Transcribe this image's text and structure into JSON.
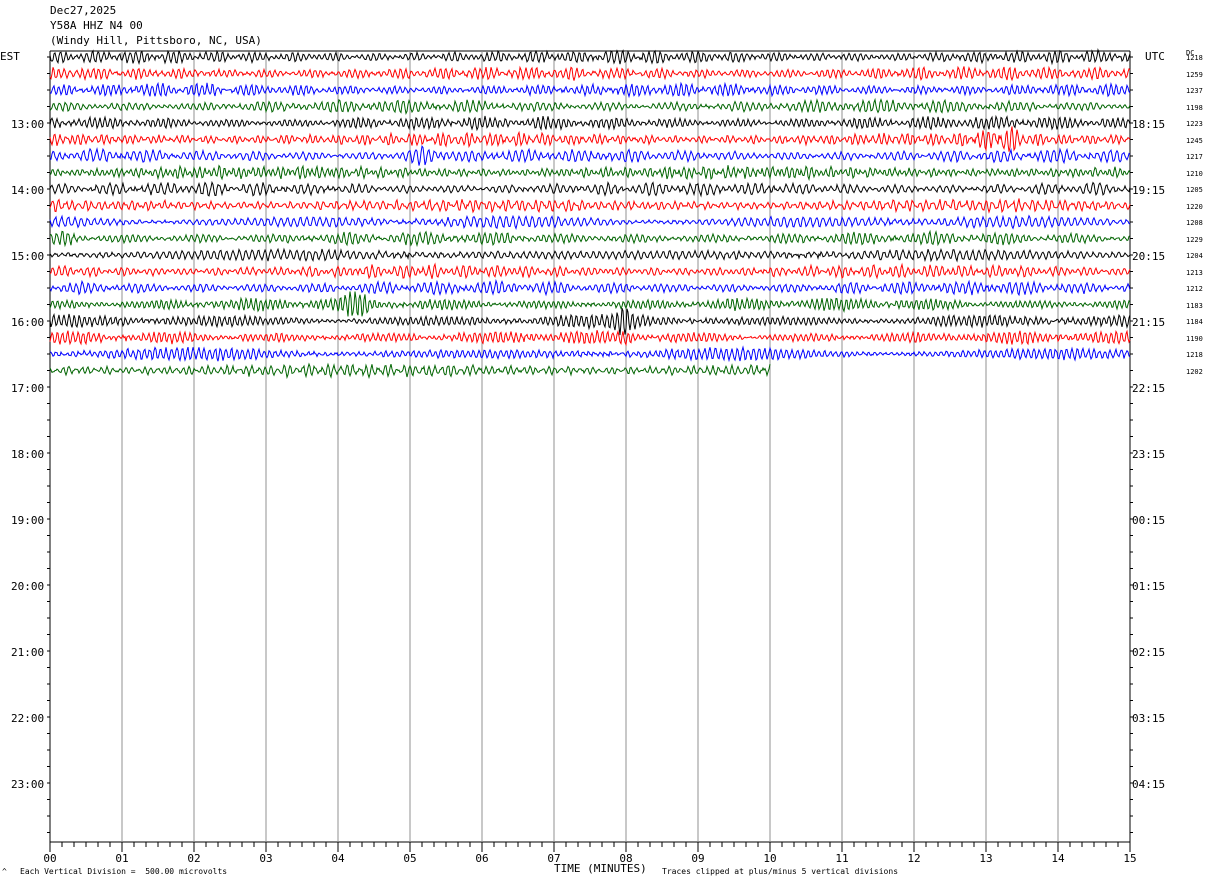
{
  "header": {
    "date": "Dec27,2025",
    "channel": "Y58A HHZ N4 00",
    "location": "(Windy Hill, Pittsboro, NC, USA)"
  },
  "left_label": "EST",
  "right_label": "UTC",
  "dc_label": "DC",
  "footer": {
    "left": "Each Vertical Division =  500.00 microvolts",
    "right": "Traces clipped at plus/minus 5 vertical divisions",
    "mark": "^"
  },
  "chart_data": {
    "type": "line",
    "title": "",
    "xlabel": "TIME (MINUTES)",
    "xlim": [
      0,
      15
    ],
    "x_ticks": [
      "00",
      "01",
      "02",
      "03",
      "04",
      "05",
      "06",
      "07",
      "08",
      "09",
      "10",
      "11",
      "12",
      "13",
      "14",
      "15"
    ],
    "est_hour_labels": [
      "13:00",
      "14:00",
      "15:00",
      "16:00",
      "17:00",
      "18:00",
      "19:00",
      "20:00",
      "21:00",
      "22:00",
      "23:00"
    ],
    "utc_hour_labels": [
      "18:15",
      "19:15",
      "20:15",
      "21:15",
      "22:15",
      "23:15",
      "00:15",
      "01:15",
      "02:15",
      "03:15",
      "04:15"
    ],
    "traces_per_hour": 4,
    "series_colors": [
      "#000000",
      "#ff0000",
      "#0000ff",
      "#006400"
    ],
    "dc_offsets": [
      "1218",
      "1259",
      "1237",
      "1198",
      "1223",
      "1245",
      "1217",
      "1210",
      "1205",
      "1220",
      "1208",
      "1229",
      "1204",
      "1213",
      "1212",
      "1183",
      "1184",
      "1190",
      "1218",
      "1202"
    ],
    "last_trace_end_minute": 10.0,
    "events": [
      {
        "trace": 5,
        "minute_start": 12.8,
        "minute_end": 13.6,
        "amp": 2.4
      },
      {
        "trace": 6,
        "minute_start": 4.9,
        "minute_end": 5.6,
        "amp": 2.2
      },
      {
        "trace": 11,
        "minute_start": 0.1,
        "minute_end": 0.35,
        "amp": 1.6
      },
      {
        "trace": 15,
        "minute_start": 4.0,
        "minute_end": 4.5,
        "amp": 2.0
      },
      {
        "trace": 16,
        "minute_start": 7.8,
        "minute_end": 8.2,
        "amp": 2.2
      },
      {
        "trace": 17,
        "minute_start": 7.9,
        "minute_end": 8.1,
        "amp": 1.6
      }
    ]
  }
}
